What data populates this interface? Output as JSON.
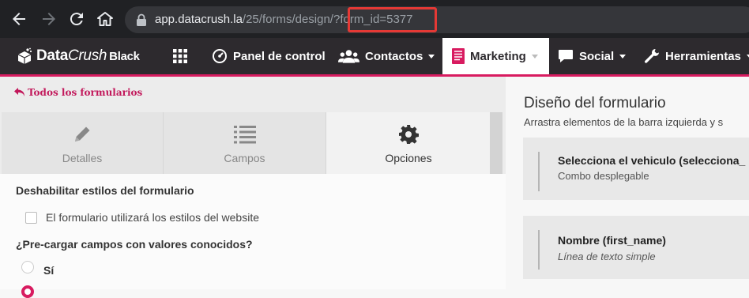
{
  "browser": {
    "url_host": "app.datacrush.la",
    "url_path": "/25/forms/design/",
    "url_query": "?form_id=5377"
  },
  "brand": {
    "name_bold": "Data",
    "name_italic": "Crush",
    "edition": "Black"
  },
  "nav": {
    "items": [
      {
        "label": "Panel de control",
        "icon": "dashboard-gauge-icon"
      },
      {
        "label": "Contactos",
        "icon": "contacts-users-icon"
      },
      {
        "label": "Marketing",
        "icon": "marketing-document-icon"
      },
      {
        "label": "Social",
        "icon": "chat-bubble-icon"
      },
      {
        "label": "Herramientas",
        "icon": "wrench-icon"
      }
    ],
    "active": "Marketing"
  },
  "left": {
    "back_link": "Todos los formularios",
    "tabs": [
      {
        "label": "Detalles",
        "icon": "pencil-icon"
      },
      {
        "label": "Campos",
        "icon": "list-icon"
      },
      {
        "label": "Opciones",
        "icon": "gear-icon"
      }
    ],
    "active_tab": "Opciones",
    "disable_styles": {
      "title": "Deshabilitar estilos del formulario",
      "checkbox_label": "El formulario utilizará los estilos del website"
    },
    "preload": {
      "title": "¿Pre-cargar campos con valores conocidos?",
      "options": [
        "Sí"
      ]
    }
  },
  "right": {
    "title": "Diseño del formulario",
    "subtitle": "Arrastra elementos de la barra izquierda y s",
    "fields": [
      {
        "name": "Selecciona el vehiculo (selecciona_",
        "type": "Combo desplegable"
      },
      {
        "name": "Nombre (first_name)",
        "type": "Línea de texto simple"
      }
    ]
  },
  "colors": {
    "accent": "#d81b60",
    "navbar": "#2d2a2e",
    "highlight": "#e53935"
  }
}
